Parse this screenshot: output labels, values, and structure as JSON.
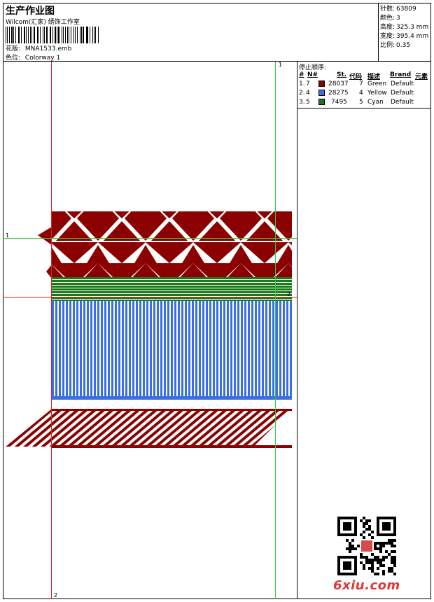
{
  "header": {
    "title": "生产作业图",
    "company": "Wilcom(汇家) 绣饰工作室",
    "design_label": "花版:",
    "design_value": "MNA1533.emb",
    "colorway_label": "色位:",
    "colorway_value": "Colorway 1"
  },
  "stats": [
    {
      "label": "针数:",
      "value": "63809"
    },
    {
      "label": "颜色:",
      "value": "3"
    },
    {
      "label": "高度:",
      "value": "325.3 mm"
    },
    {
      "label": "宽度:",
      "value": "395.4 mm"
    },
    {
      "label": "比例:",
      "value": "0.35"
    }
  ],
  "stop_sequence": {
    "title": "停止顺序:",
    "headers": [
      "#",
      "N#",
      "St.",
      "代码",
      "描述",
      "Brand",
      "元素"
    ],
    "rows": [
      {
        "idx": "1.",
        "num": "7",
        "color": "#8b0000",
        "stitches": "28037",
        "code": "7",
        "desc": "Green",
        "brand": "Default"
      },
      {
        "idx": "2.",
        "num": "4",
        "color": "#3a6fe8",
        "stitches": "28275",
        "code": "4",
        "desc": "Yellow",
        "brand": "Default"
      },
      {
        "idx": "3.",
        "num": "5",
        "color": "#1a7a1a",
        "stitches": "7495",
        "code": "5",
        "desc": "Cyan",
        "brand": "Default"
      }
    ]
  },
  "guides": {
    "label_1": "1",
    "label_2": "2"
  },
  "colors": {
    "maroon": "#8b0000",
    "blue": "#3a6fe8",
    "green": "#1a7a1a",
    "guide_green": "#33cc33",
    "guide_red": "#dd2222"
  },
  "watermark": "6xiu.com"
}
